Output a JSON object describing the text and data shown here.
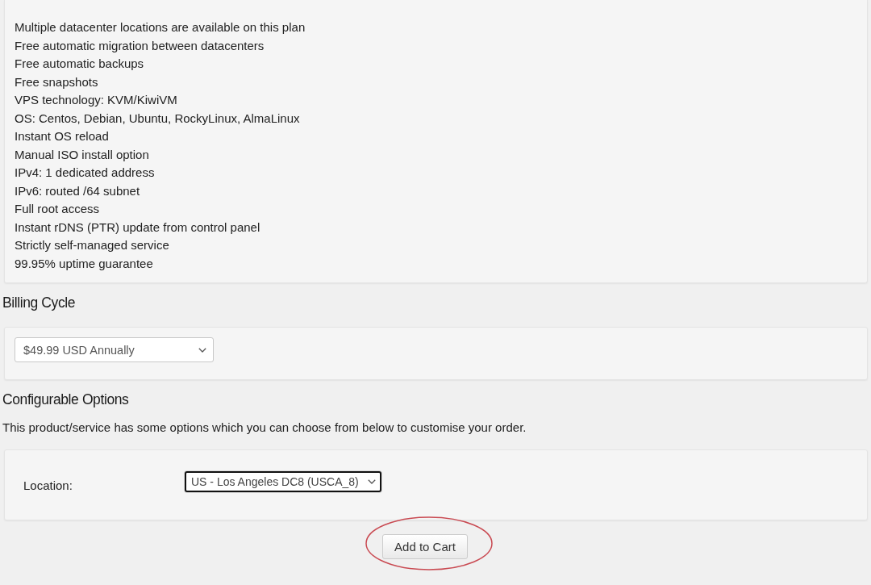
{
  "features": [
    "Multiple datacenter locations are available on this plan",
    "Free automatic migration between datacenters",
    "Free automatic backups",
    "Free snapshots",
    "VPS technology: KVM/KiwiVM",
    "OS: Centos, Debian, Ubuntu, RockyLinux, AlmaLinux",
    "Instant OS reload",
    "Manual ISO install option",
    "IPv4: 1 dedicated address",
    "IPv6: routed /64 subnet",
    "Full root access",
    "Instant rDNS (PTR) update from control panel",
    "Strictly self-managed service",
    "99.95% uptime guarantee"
  ],
  "billing_cycle": {
    "heading": "Billing Cycle",
    "value": "$49.99 USD Annually",
    "focused": false
  },
  "configurable_options": {
    "heading": "Configurable Options",
    "description": "This product/service has some options which you can choose from below to customise your order.",
    "options": [
      {
        "label": "Location:",
        "value": "US - Los Angeles DC8 (USCA_8)",
        "focused": true
      }
    ]
  },
  "add_to_cart": {
    "label": "Add to Cart",
    "circled": true
  }
}
